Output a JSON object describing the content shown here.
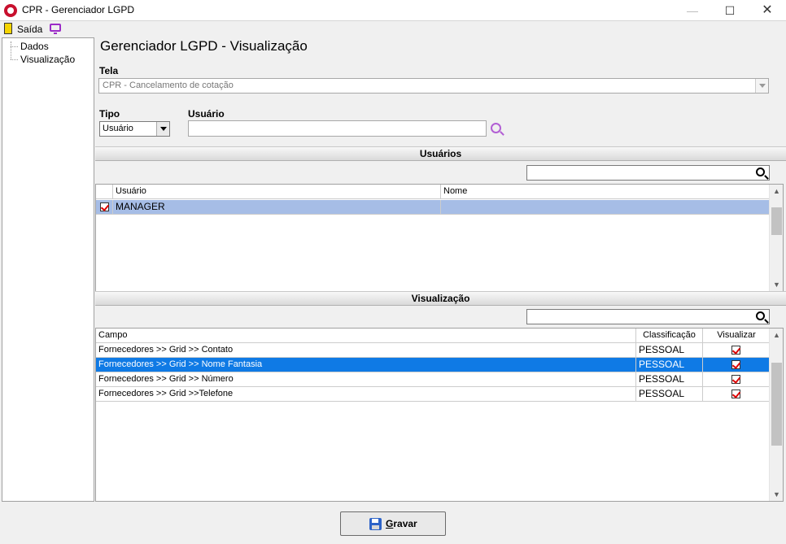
{
  "window": {
    "title": "CPR - Gerenciador LGPD"
  },
  "toolbar": {
    "exit_label": "Saída"
  },
  "tree": {
    "items": [
      "Dados",
      "Visualização"
    ]
  },
  "main": {
    "title": "Gerenciador LGPD - Visualização",
    "tela_label": "Tela",
    "tela_value": "CPR - Cancelamento de cotação",
    "tipo_label": "Tipo",
    "tipo_value": "Usuário",
    "usuario_label": "Usuário",
    "usuario_value": ""
  },
  "users_section": {
    "title": "Usuários",
    "filter_value": "",
    "columns": [
      "Usuário",
      "Nome"
    ],
    "rows": [
      {
        "usuario": "MANAGER",
        "nome": "",
        "checked": true
      }
    ]
  },
  "view_section": {
    "title": "Visualização",
    "filter_value": "",
    "columns": [
      "Campo",
      "Classificação",
      "Visualizar"
    ],
    "rows": [
      {
        "campo": "Fornecedores >> Grid >> Contato",
        "classificacao": "PESSOAL",
        "visualizar": true
      },
      {
        "campo": "Fornecedores >> Grid >> Nome Fantasia",
        "classificacao": "PESSOAL",
        "visualizar": true
      },
      {
        "campo": "Fornecedores >> Grid >> Número",
        "classificacao": "PESSOAL",
        "visualizar": true
      },
      {
        "campo": "Fornecedores >> Grid >>Telefone",
        "classificacao": "PESSOAL",
        "visualizar": true
      }
    ]
  },
  "footer": {
    "save_label": "Gravar"
  },
  "colors": {
    "selection_light": "#a6bde6",
    "selection_dark": "#0f7ae5",
    "accent_purple": "#9b2cc7"
  }
}
